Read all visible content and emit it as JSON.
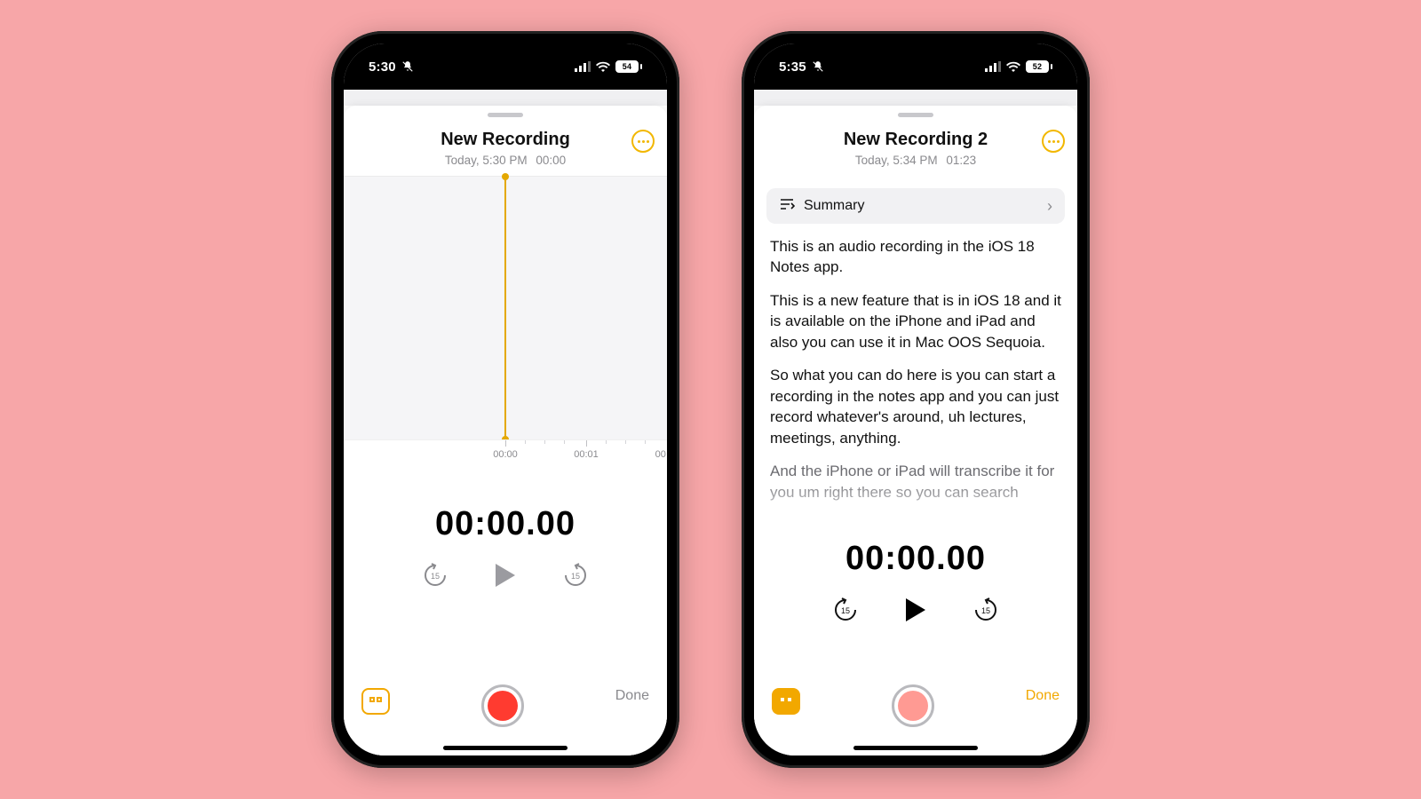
{
  "accent": "#f2a800",
  "left": {
    "status": {
      "time": "5:30",
      "battery": "54"
    },
    "header": {
      "title": "New Recording",
      "date": "Today, 5:30 PM",
      "duration": "00:00"
    },
    "timeline": {
      "t0": "00:00",
      "t1": "00:01",
      "t2_partial": "00"
    },
    "timer": "00:00.00",
    "controls": {
      "back_sec": "15",
      "fwd_sec": "15",
      "play_color": "#9b9ba0"
    },
    "bottom": {
      "done_label": "Done",
      "done_state": "disabled",
      "quote_style": "outline",
      "record_state": "active"
    }
  },
  "right": {
    "status": {
      "time": "5:35",
      "battery": "52"
    },
    "header": {
      "title": "New Recording 2",
      "date": "Today, 5:34 PM",
      "duration": "01:23"
    },
    "summary_label": "Summary",
    "transcript": {
      "p1": "This is an audio recording in the iOS 18 Notes app.",
      "p2": "This is a new feature that is in iOS 18 and it is available on the iPhone and iPad and also you can use it in Mac OOS Sequoia.",
      "p3": "So what you can do here is you can start a recording in the notes app and you can just record whatever's around, uh lectures, meetings, anything.",
      "p4": "And the iPhone or iPad will transcribe it for you um right there so you can search"
    },
    "timer": "00:00.00",
    "controls": {
      "back_sec": "15",
      "fwd_sec": "15",
      "play_color": "#000000"
    },
    "bottom": {
      "done_label": "Done",
      "done_state": "active",
      "quote_style": "fill",
      "record_state": "inactive"
    }
  }
}
